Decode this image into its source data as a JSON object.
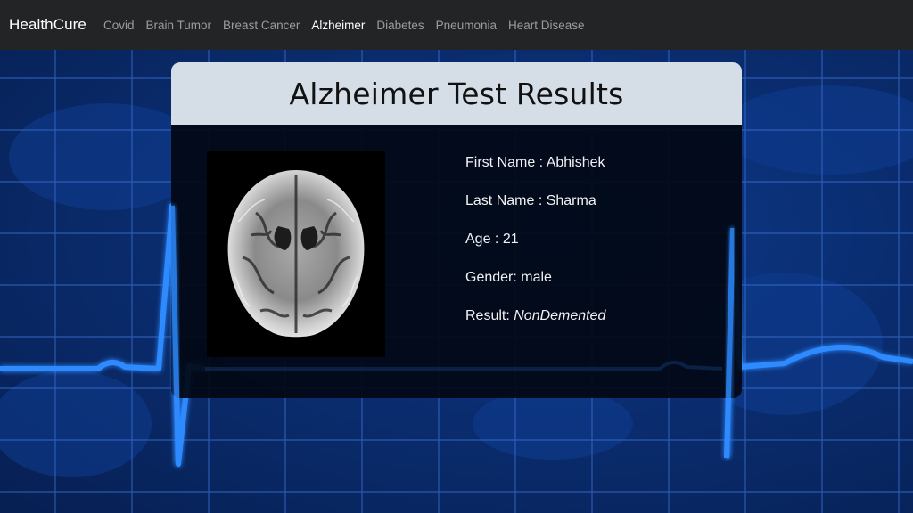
{
  "navbar": {
    "brand": "HealthCure",
    "links": [
      {
        "label": "Covid",
        "active": false
      },
      {
        "label": "Brain Tumor",
        "active": false
      },
      {
        "label": "Breast Cancer",
        "active": false
      },
      {
        "label": "Alzheimer",
        "active": true
      },
      {
        "label": "Diabetes",
        "active": false
      },
      {
        "label": "Pneumonia",
        "active": false
      },
      {
        "label": "Heart Disease",
        "active": false
      }
    ]
  },
  "card": {
    "title": "Alzheimer Test Results",
    "image_icon": "brain-mri-scan",
    "fields": {
      "first_name_label": "First Name : ",
      "first_name": "Abhishek",
      "last_name_label": "Last Name : ",
      "last_name": "Sharma",
      "age_label": "Age : ",
      "age": "21",
      "gender_label": "Gender: ",
      "gender": "male",
      "result_label": "Result: ",
      "result": "NonDemented"
    }
  },
  "colors": {
    "navbar_bg": "#222426",
    "nav_active": "#ffffff",
    "nav_inactive": "#9a9c9f",
    "card_header_bg": "#d5dde6",
    "card_body_bg": "#02080f",
    "ecg_line": "#2f8bff",
    "background": "#0a2d70"
  }
}
